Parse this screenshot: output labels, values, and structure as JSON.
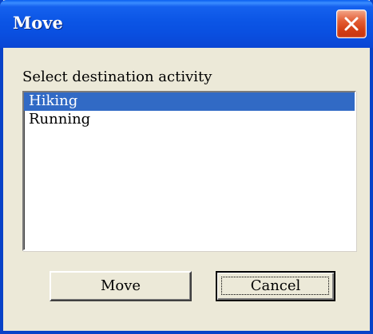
{
  "window": {
    "title": "Move",
    "close_icon": "close-icon"
  },
  "prompt_label": "Select destination activity",
  "activities": {
    "selected_index": 0,
    "items": [
      "Hiking",
      "Running"
    ]
  },
  "buttons": {
    "move_label": "Move",
    "cancel_label": "Cancel"
  },
  "colors": {
    "titlebar": "#0a4fe0",
    "selection": "#316ac5",
    "close_button": "#d23d12",
    "dialog_face": "#ece9d8"
  }
}
